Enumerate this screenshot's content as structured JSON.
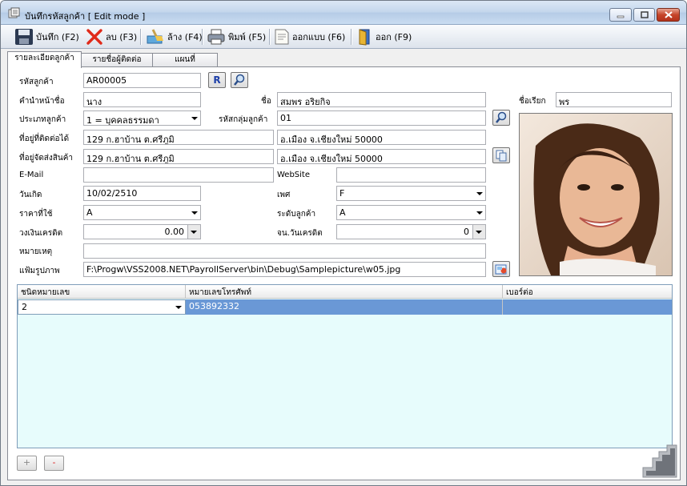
{
  "window": {
    "title": "บันทึกรหัสลูกค้า [ Edit mode ]"
  },
  "toolbar": {
    "save": "บันทึก (F2)",
    "delete": "ลบ (F3)",
    "clear": "ล้าง (F4)",
    "print": "พิมพ์ (F5)",
    "design": "ออกแบบ (F6)",
    "exit": "ออก (F9)"
  },
  "tabs": [
    "รายละเอียดลูกค้า",
    "รายชื่อผู้ติดต่อ",
    "แผนที่"
  ],
  "form": {
    "customer_code_label": "รหัสลูกค้า",
    "customer_code": "AR00005",
    "r_button": "R",
    "prefix_label": "คำนำหน้าชื่อ",
    "prefix": "นาง",
    "name_label": "ชื่อ",
    "name": "สมพร อริยกิจ",
    "nickname_label": "ชื่อเรียก",
    "nickname": "พร",
    "type_label": "ประเภทลูกค้า",
    "type": "1 = บุคคลธรรมดา",
    "group_label": "รหัสกลุ่มลูกค้า",
    "group": "01",
    "contact_addr_label": "ที่อยู่ที่ติดต่อได้",
    "contact_addr1": "129 ก.ฮาบ้าน ต.ศรีภูมิ",
    "contact_addr2": "อ.เมือง จ.เชียงใหม่ 50000",
    "ship_addr_label": "ที่อยู่จัดส่งสินค้า",
    "ship_addr1": "129 ก.ฮาบ้าน ต.ศรีภูมิ",
    "ship_addr2": "อ.เมือง จ.เชียงใหม่ 50000",
    "email_label": "E-Mail",
    "email": "",
    "website_label": "WebSite",
    "website": "",
    "birth_label": "วันเกิด",
    "birth": "10/02/2510",
    "sex_label": "เพศ",
    "sex": "F",
    "price_label": "ราคาที่ใช้",
    "price": "A",
    "level_label": "ระดับลูกค้า",
    "level": "A",
    "credit_label": "วงเงินเครดิต",
    "credit": "0.00",
    "credit_days_label": "จน.วันเครดิต",
    "credit_days": "0",
    "note_label": "หมายเหตุ",
    "note": "",
    "photo_label": "แฟ้มรูปภาพ",
    "photo_path": "F:\\Progw\\VSS2008.NET\\PayrollServer\\bin\\Debug\\Samplepicture\\w05.jpg"
  },
  "grid": {
    "columns": [
      "ชนิดหมายเลข",
      "หมายเลขโทรศัพท์",
      "เบอร์ต่อ"
    ],
    "rows": [
      {
        "type": "2",
        "phone": "053892332",
        "ext": ""
      }
    ]
  },
  "buttons": {
    "add": "+",
    "remove": "-"
  },
  "colors": {
    "selected_row": "#6a98d6",
    "grid_bg": "#e7fcfc"
  }
}
